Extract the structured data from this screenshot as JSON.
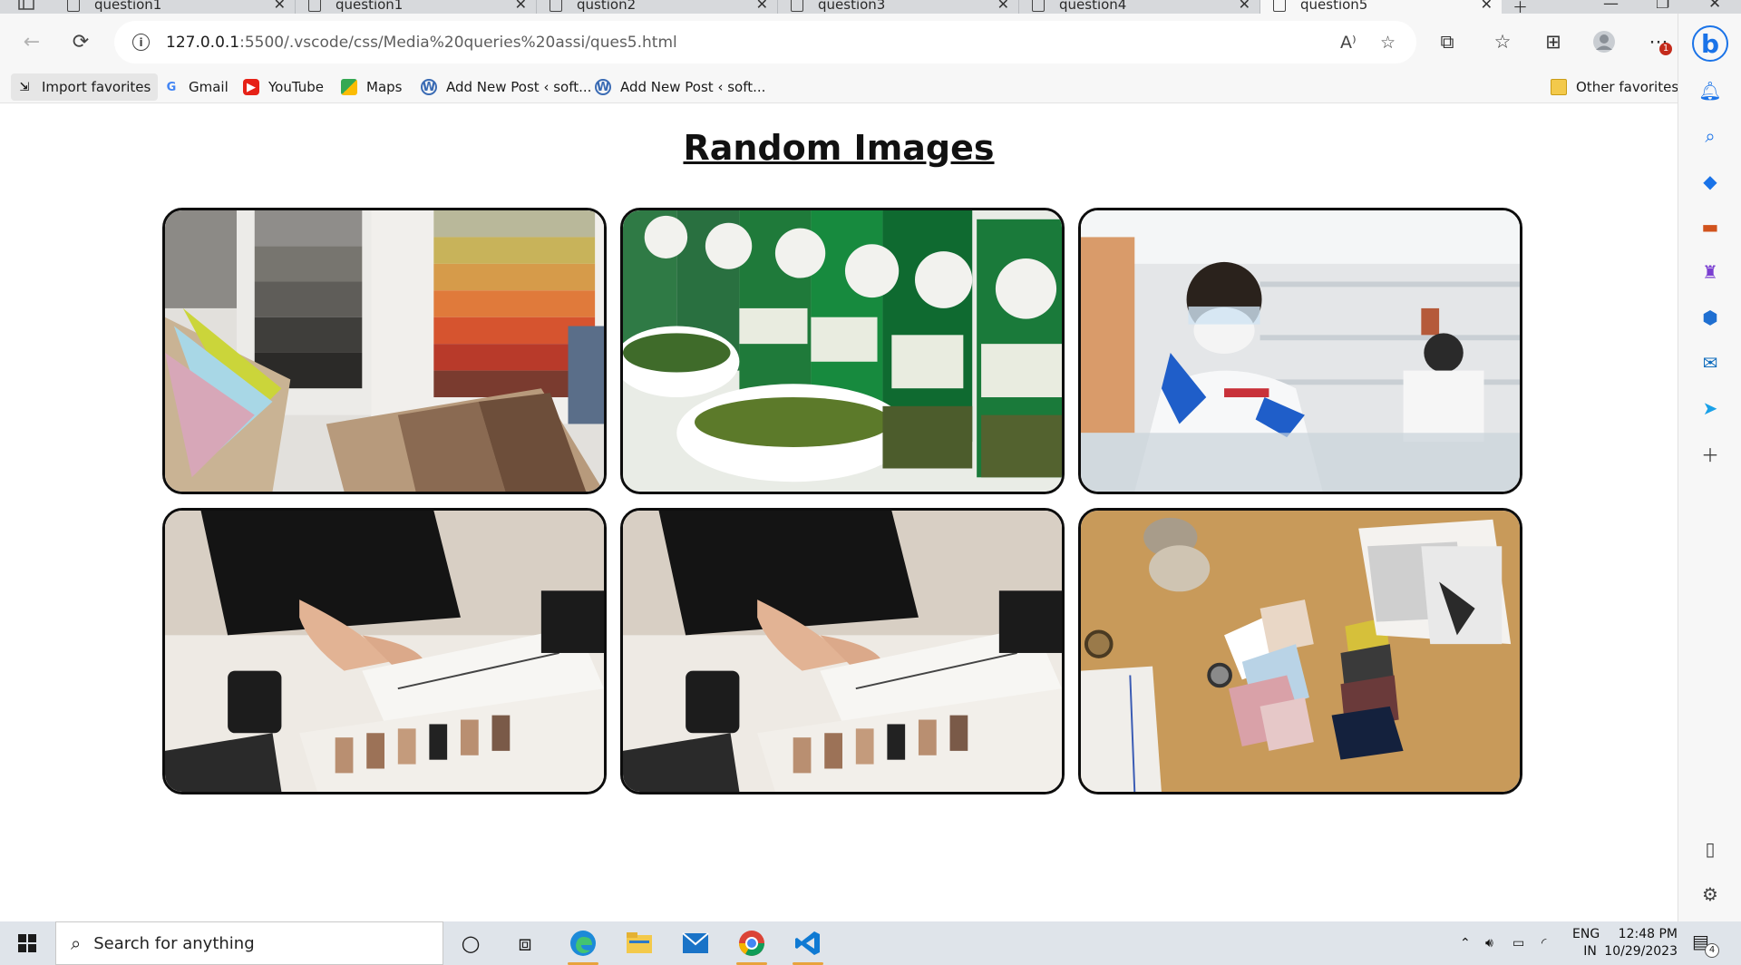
{
  "browser": {
    "tabs": [
      {
        "title": "question1",
        "active": false
      },
      {
        "title": "question1",
        "active": false
      },
      {
        "title": "qustion2",
        "active": false
      },
      {
        "title": "question3",
        "active": false
      },
      {
        "title": "question4",
        "active": false
      },
      {
        "title": "question5",
        "active": true
      }
    ],
    "url_host": "127.0.0.1",
    "url_path": ":5500/.vscode/css/Media%20queries%20assi/ques5.html",
    "notification_badge": "1",
    "favorites": {
      "import_label": "Import favorites",
      "items": [
        "Gmail",
        "YouTube",
        "Maps",
        "Add New Post ‹ soft...",
        "Add New Post ‹ soft..."
      ],
      "other_label": "Other favorites"
    },
    "read_aloud_label": "A",
    "bing_label": "b"
  },
  "page": {
    "title": "Random Images",
    "images": [
      {
        "name": "fabric-swatches",
        "colors": [
          "#8c8a86",
          "#6d6b68",
          "#c8b35a",
          "#d6542f",
          "#e2e0dc",
          "#b79a7c"
        ]
      },
      {
        "name": "spice-jars",
        "colors": [
          "#1f7a3a",
          "#0f5a28",
          "#e9ece6",
          "#5c7a2a",
          "#ffffff"
        ]
      },
      {
        "name": "lab-scientist",
        "colors": [
          "#e4e6e8",
          "#f4f6f7",
          "#1f5ec9",
          "#c9d3da",
          "#efe9e2"
        ]
      },
      {
        "name": "fashion-sketching",
        "colors": [
          "#eeeae4",
          "#141414",
          "#d8cfc4",
          "#1c1c1c",
          "#b98f71"
        ]
      },
      {
        "name": "fashion-sketching",
        "colors": [
          "#eeeae4",
          "#141414",
          "#d8cfc4",
          "#1c1c1c",
          "#b98f71"
        ]
      },
      {
        "name": "craft-table",
        "colors": [
          "#c89a5a",
          "#e9d7c6",
          "#14213d",
          "#3a3a3a",
          "#d9a1a8"
        ]
      }
    ]
  },
  "taskbar": {
    "search_placeholder": "Search for anything",
    "language_top": "ENG",
    "language_bottom": "IN",
    "time": "12:48 PM",
    "date": "10/29/2023",
    "notification_count": "4"
  }
}
